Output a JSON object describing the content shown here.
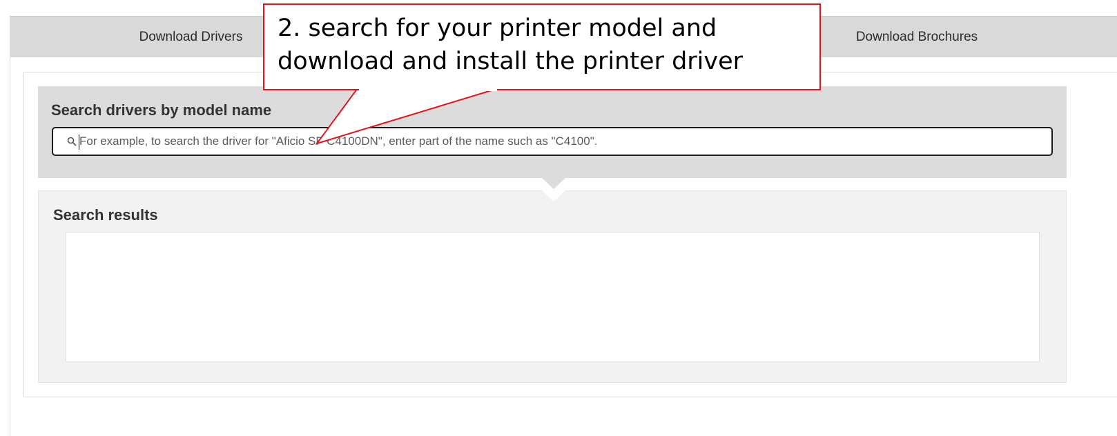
{
  "tabs": [
    {
      "label": "Download Drivers"
    },
    {
      "label": "Download Brochures"
    }
  ],
  "search": {
    "title": "Search drivers by model name",
    "placeholder": "For example, to search the driver for \"Aficio SP C4100DN\", enter part of the name such as \"C4100\".",
    "value": ""
  },
  "results": {
    "title": "Search results"
  },
  "annotation": {
    "line1": "2. search for your printer model and",
    "line2": "download and install the printer driver",
    "color": "#e3141c"
  }
}
